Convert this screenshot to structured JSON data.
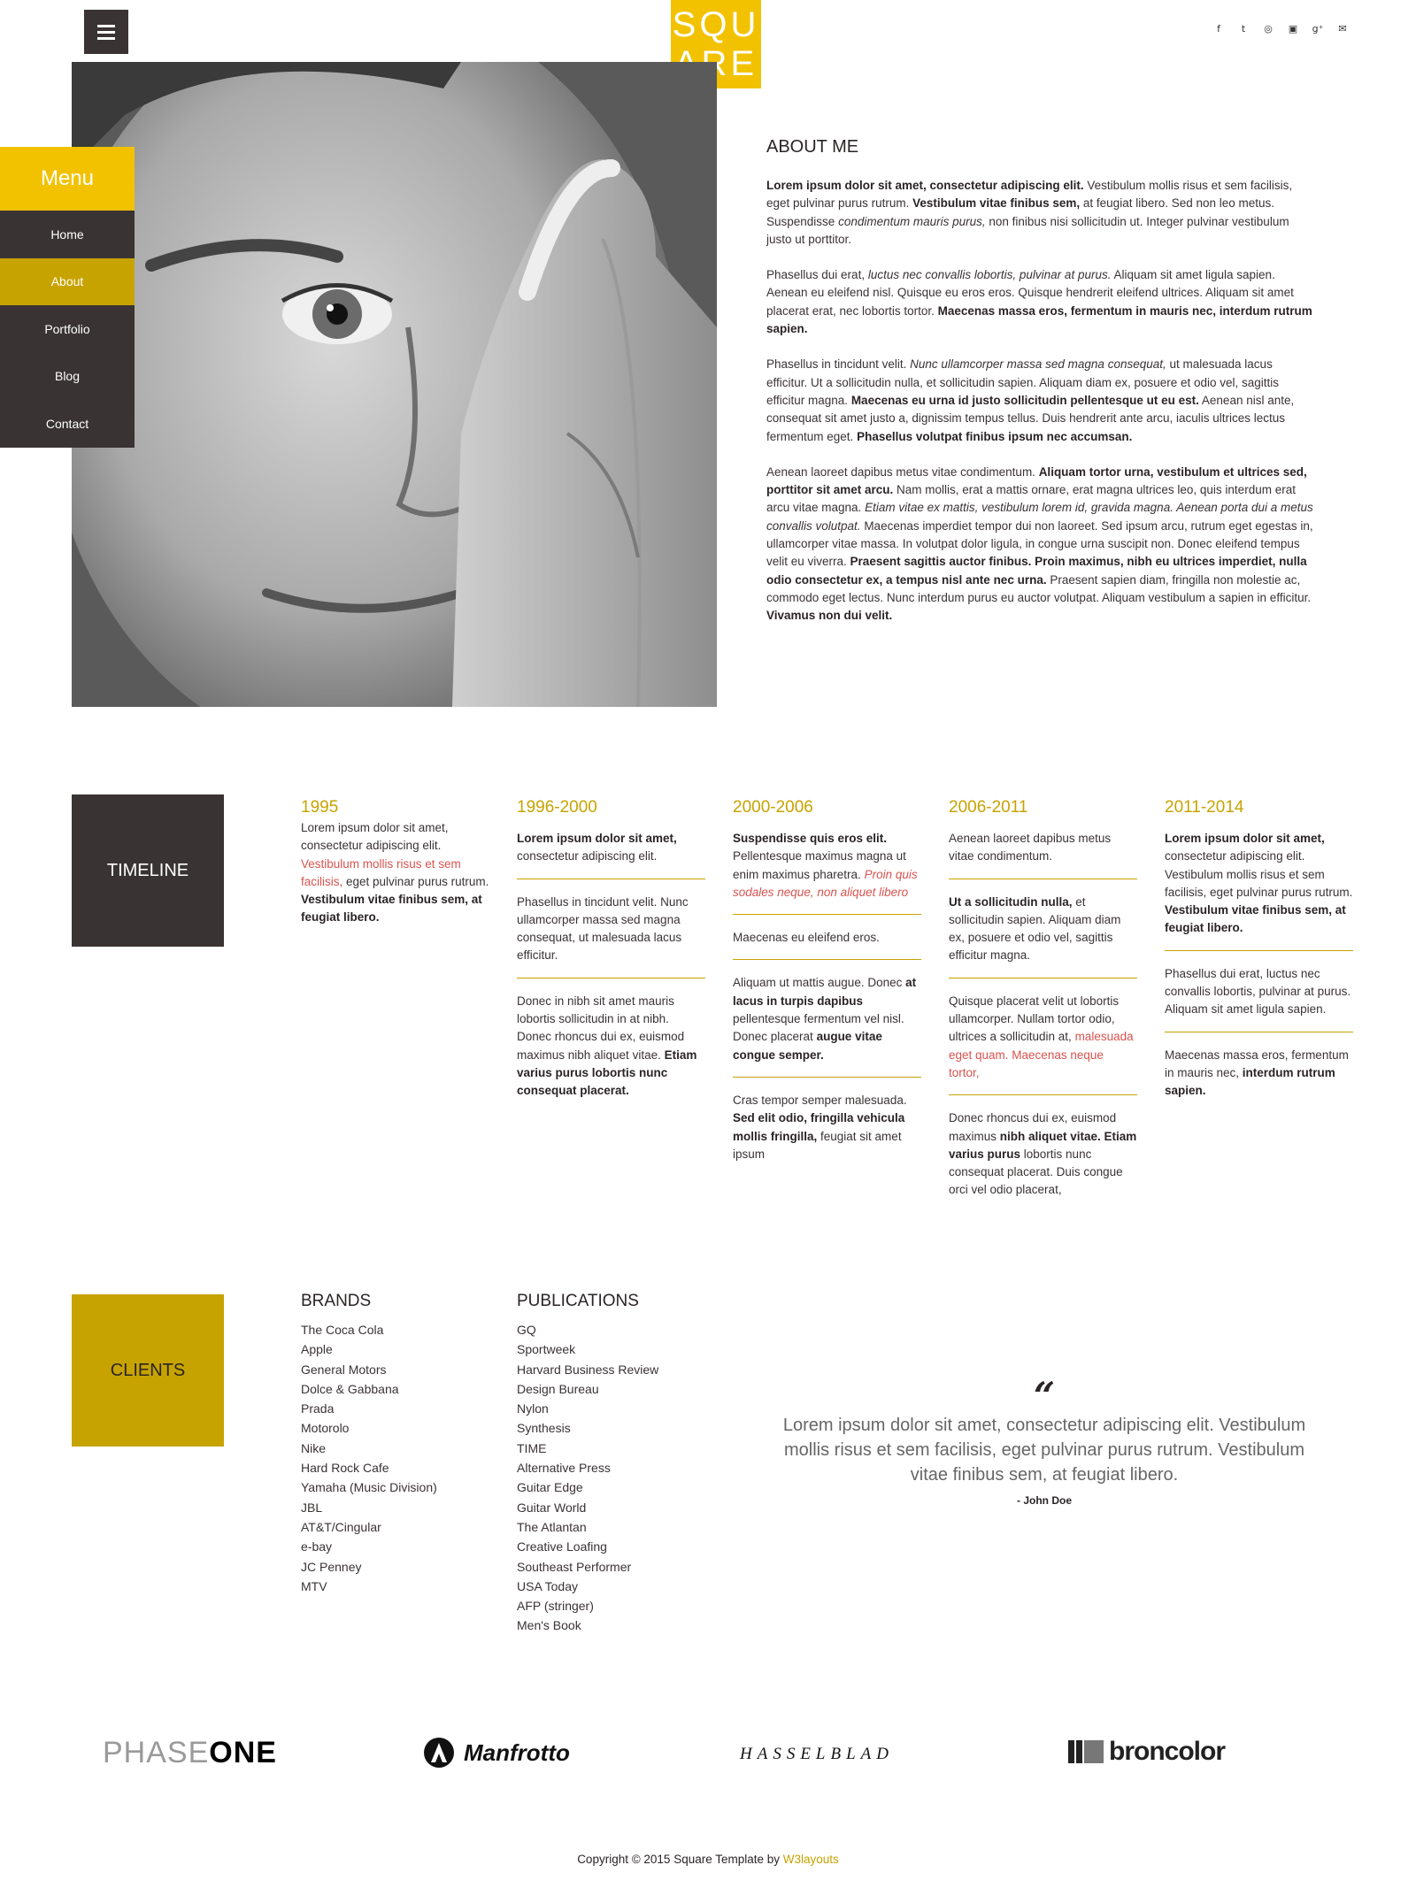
{
  "header": {
    "logo_top": "SQU",
    "logo_bottom": "ARE",
    "social": [
      "f",
      "t",
      "◎",
      "▣",
      "g⁺",
      "✉"
    ]
  },
  "menu": {
    "title": "Menu",
    "items": [
      "Home",
      "About",
      "Portfolio",
      "Blog",
      "Contact"
    ],
    "active": "About"
  },
  "about": {
    "heading": "ABOUT ME",
    "p1_b1": "Lorem ipsum dolor sit amet, consectetur adipiscing elit.",
    "p1_t1": " Vestibulum mollis risus et sem facilisis, eget pulvinar purus rutrum. ",
    "p1_b2": "Vestibulum vitae finibus sem,",
    "p1_t2": " at feugiat libero. Sed non leo metus. Suspendisse ",
    "p1_i1": "condimentum mauris purus,",
    "p1_t3": " non finibus nisi sollicitudin ut. Integer pulvinar vestibulum justo ut porttitor.",
    "p2_t1": "Phasellus dui erat, ",
    "p2_i1": "luctus nec convallis lobortis, pulvinar at purus.",
    "p2_t2": " Aliquam sit amet ligula sapien. Aenean eu eleifend nisl. Quisque eu eros eros. Quisque hendrerit eleifend ultrices. Aliquam sit amet placerat erat, nec lobortis tortor. ",
    "p2_b1": "Maecenas massa eros, fermentum in mauris nec, interdum rutrum sapien.",
    "p3_t1": "Phasellus in tincidunt velit. ",
    "p3_i1": "Nunc ullamcorper massa sed magna consequat,",
    "p3_t2": " ut malesuada lacus efficitur. Ut a sollicitudin nulla, et sollicitudin sapien. Aliquam diam ex, posuere et odio vel, sagittis efficitur magna. ",
    "p3_b1": "Maecenas eu urna id justo sollicitudin pellentesque ut eu est.",
    "p3_t3": " Aenean nisl ante, consequat sit amet justo a, dignissim tempus tellus. Duis hendrerit ante arcu, iaculis ultrices lectus fermentum eget. ",
    "p3_b2": "Phasellus volutpat finibus ipsum nec accumsan.",
    "p4_t1": "Aenean laoreet dapibus metus vitae condimentum. ",
    "p4_b1": "Aliquam tortor urna, vestibulum et ultrices sed, porttitor sit amet arcu.",
    "p4_t2": " Nam mollis, erat a mattis ornare, erat magna ultrices leo, quis interdum erat arcu vitae magna. ",
    "p4_i1": "Etiam vitae ex mattis, vestibulum lorem id, gravida magna. Aenean porta dui a metus convallis volutpat.",
    "p4_t3": " Maecenas imperdiet tempor dui non laoreet. Sed ipsum arcu, rutrum eget egestas in, ullamcorper vitae massa. In volutpat dolor ligula, in congue urna suscipit non. Donec eleifend tempus velit eu viverra. ",
    "p4_b2": "Praesent sagittis auctor finibus. Proin maximus, nibh eu ultrices imperdiet, nulla odio consectetur ex, a tempus nisl ante nec urna.",
    "p4_t4": " Praesent sapien diam, fringilla non molestie ac, commodo eget lectus. Nunc interdum purus eu auctor volutpat. Aliquam vestibulum a sapien in efficitur. ",
    "p4_b3": "Vivamus non dui velit."
  },
  "timeline": {
    "title": "TIMELINE",
    "c1": {
      "year": "1995",
      "e1_t1": "Lorem ipsum dolor sit amet, consectetur adipiscing elit. ",
      "e1_r1": "Vestibulum mollis risus et sem facilisis,",
      "e1_t2": " eget pulvinar purus rutrum. ",
      "e1_b1": "Vestibulum vitae finibus sem, at feugiat libero."
    },
    "c2": {
      "year": "1996-2000",
      "e1_b1": "Lorem ipsum dolor sit amet,",
      "e1_t1": " consectetur adipiscing elit.",
      "e2_t1": "Phasellus in tincidunt velit. Nunc ullamcorper massa sed magna consequat, ut malesuada lacus efficitur.",
      "e3_t1": "Donec in nibh sit amet mauris lobortis sollicitudin in at nibh. Donec rhoncus dui ex, euismod maximus nibh aliquet vitae. ",
      "e3_b1": "Etiam varius purus lobortis nunc consequat placerat."
    },
    "c3": {
      "year": "2000-2006",
      "e1_b1": "Suspendisse quis eros elit.",
      "e1_t1": " Pellentesque maximus magna ut enim maximus pharetra. ",
      "e1_r1": "Proin quis sodales neque, non aliquet libero",
      "e2_t1": "Maecenas eu eleifend eros.",
      "e3_t1": "Aliquam ut mattis augue. Donec ",
      "e3_b1": "at lacus in turpis dapibus",
      "e3_t2": " pellentesque fermentum vel nisl. Donec placerat ",
      "e3_b2": "augue vitae congue semper.",
      "e4_t1": "Cras tempor semper malesuada. ",
      "e4_b1": "Sed elit odio, fringilla vehicula mollis fringilla,",
      "e4_t2": " feugiat sit amet ipsum"
    },
    "c4": {
      "year": "2006-2011",
      "e1_t1": "Aenean laoreet dapibus metus vitae condimentum.",
      "e2_b1": "Ut a sollicitudin nulla,",
      "e2_t1": " et sollicitudin sapien. Aliquam diam ex, posuere et odio vel, sagittis efficitur magna.",
      "e3_t1": "Quisque placerat velit ut lobortis ullamcorper. Nullam tortor odio, ultrices a sollicitudin at, ",
      "e3_r1": "malesuada eget quam. Maecenas neque tortor,",
      "e4_t1": "Donec rhoncus dui ex, euismod maximus ",
      "e4_b1": "nibh aliquet vitae. Etiam varius purus",
      "e4_t2": " lobortis nunc consequat placerat. Duis congue orci vel odio placerat,"
    },
    "c5": {
      "year": "2011-2014",
      "e1_b1": "Lorem ipsum dolor sit amet,",
      "e1_t1": " consectetur adipiscing elit. Vestibulum mollis risus et sem facilisis, eget pulvinar purus rutrum. ",
      "e1_b2": "Vestibulum vitae finibus sem, at feugiat libero.",
      "e2_t1": "Phasellus dui erat, luctus nec convallis lobortis, pulvinar at purus. Aliquam sit amet ligula sapien.",
      "e3_t1": "Maecenas massa eros, fermentum in mauris nec, ",
      "e3_b1": "interdum rutrum sapien."
    }
  },
  "clients": {
    "title": "CLIENTS",
    "brands_heading": "BRANDS",
    "brands": [
      "The Coca Cola",
      "Apple",
      "General Motors",
      "Dolce & Gabbana",
      "Prada",
      "Motorolo",
      "Nike",
      "Hard Rock Cafe",
      "Yamaha (Music Division)",
      "JBL",
      "AT&T/Cingular",
      "e-bay",
      "JC Penney",
      "MTV"
    ],
    "publications_heading": "PUBLICATIONS",
    "publications": [
      "GQ",
      "Sportweek",
      "Harvard Business Review",
      "Design Bureau",
      "Nylon",
      "Synthesis",
      "TIME",
      "Alternative Press",
      "Guitar Edge",
      "Guitar World",
      "The Atlantan",
      "Creative Loafing",
      "Southeast Performer",
      "USA Today",
      "AFP (stringer)",
      "Men's Book"
    ]
  },
  "quote": {
    "mark": "“",
    "text": "Lorem ipsum dolor sit amet, consectetur adipiscing elit. Vestibulum mollis risus et sem facilisis, eget pulvinar purus rutrum. Vestibulum vitae finibus sem, at feugiat libero.",
    "author": "- John Doe"
  },
  "partners": {
    "phase_light": "PHASE",
    "phase_bold": "ONE",
    "manfrotto": "Manfrotto",
    "hasselblad": "HASSELBLAD",
    "broncolor": "broncolor"
  },
  "footer": {
    "text": "Copyright © 2015 Square Template by ",
    "link": "W3layouts"
  }
}
